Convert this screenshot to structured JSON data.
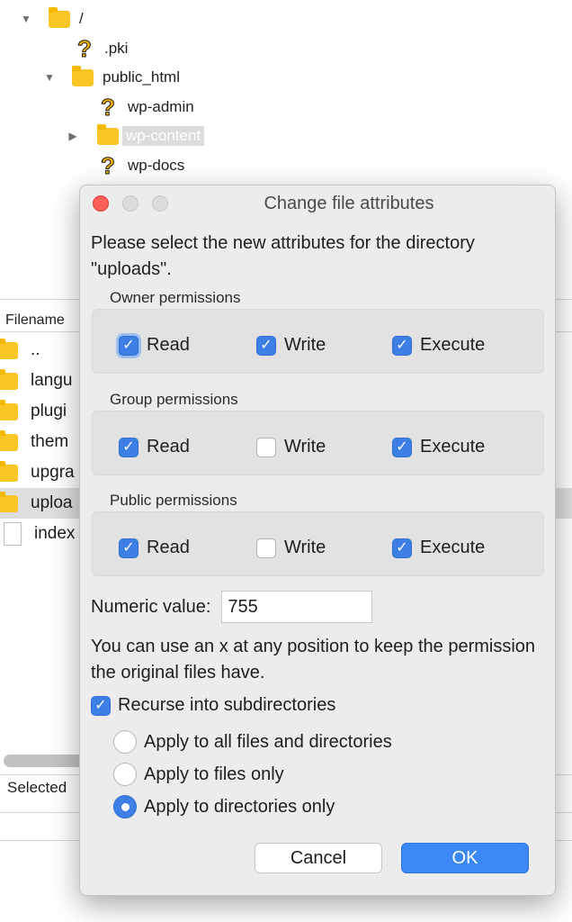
{
  "tree": {
    "items": [
      {
        "label": "/",
        "icon": "folder-icon",
        "expanded": true
      },
      {
        "label": ".pki",
        "icon": "question-mark-icon"
      },
      {
        "label": "public_html",
        "icon": "folder-icon",
        "expanded": true
      },
      {
        "label": "wp-admin",
        "icon": "question-mark-icon"
      },
      {
        "label": "wp-content",
        "icon": "folder-icon",
        "expanded": false,
        "selected": true
      },
      {
        "label": "wp-docs",
        "icon": "question-mark-icon"
      }
    ]
  },
  "file_list": {
    "header": "Filename",
    "rows": [
      {
        "name": "..",
        "icon": "folder-icon"
      },
      {
        "name": "langu",
        "icon": "folder-icon"
      },
      {
        "name": "plugi",
        "icon": "folder-icon"
      },
      {
        "name": "them",
        "icon": "folder-icon"
      },
      {
        "name": "upgra",
        "icon": "folder-icon"
      },
      {
        "name": "uploa",
        "icon": "folder-icon",
        "selected": true
      },
      {
        "name": "index",
        "icon": "file-icon"
      }
    ],
    "status": "Selected"
  },
  "dialog": {
    "title": "Change file attributes",
    "prompt": "Please select the new attributes for the directory \"uploads\".",
    "groups": [
      {
        "label": "Owner permissions",
        "read": {
          "label": "Read",
          "checked": true
        },
        "write": {
          "label": "Write",
          "checked": true
        },
        "execute": {
          "label": "Execute",
          "checked": true
        }
      },
      {
        "label": "Group permissions",
        "read": {
          "label": "Read",
          "checked": true
        },
        "write": {
          "label": "Write",
          "checked": false
        },
        "execute": {
          "label": "Execute",
          "checked": true
        }
      },
      {
        "label": "Public permissions",
        "read": {
          "label": "Read",
          "checked": true
        },
        "write": {
          "label": "Write",
          "checked": false
        },
        "execute": {
          "label": "Execute",
          "checked": true
        }
      }
    ],
    "numeric_label": "Numeric value:",
    "numeric_value": "755",
    "hint": "You can use an x at any position to keep the permission the original files have.",
    "recurse": {
      "label": "Recurse into subdirectories",
      "checked": true
    },
    "apply_options": [
      {
        "label": "Apply to all files and directories",
        "selected": false
      },
      {
        "label": "Apply to files only",
        "selected": false
      },
      {
        "label": "Apply to directories only",
        "selected": true
      }
    ],
    "cancel_label": "Cancel",
    "ok_label": "OK"
  },
  "colors": {
    "accent": "#3d7fe4",
    "folder": "#f9c626",
    "close_button": "#fe5f57"
  }
}
